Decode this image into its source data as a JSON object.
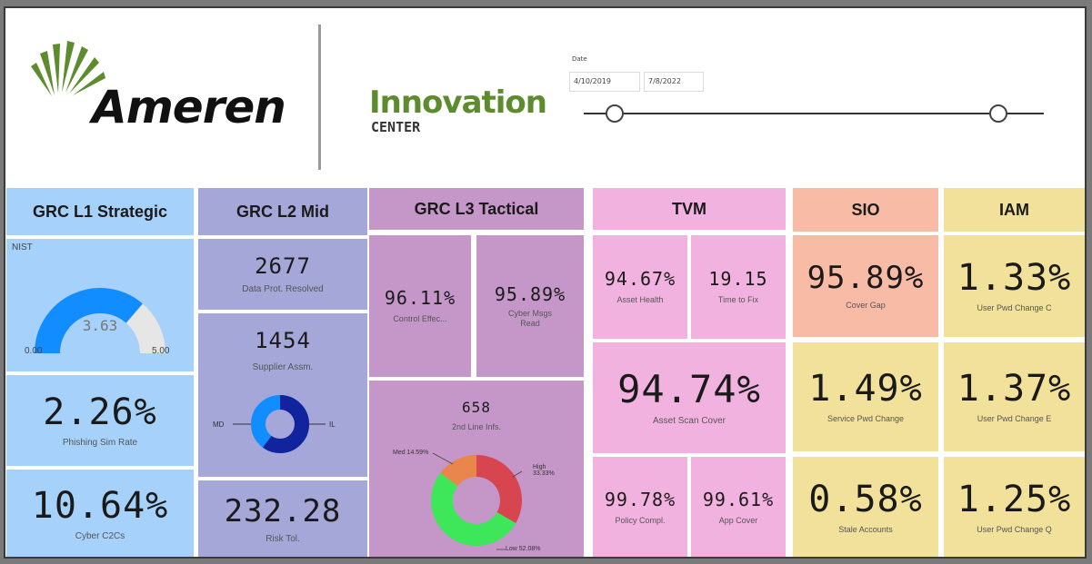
{
  "header": {
    "logo_text": "Ameren",
    "innovation": "Innovation",
    "center": "CENTER",
    "date_label": "Date",
    "date_start": "4/10/2019",
    "date_end": "7/8/2022"
  },
  "colors": {
    "l1": "#a6d1fb",
    "l2": "#a4a7d8",
    "l3": "#c597c9",
    "tvm": "#f2b2e0",
    "sio": "#f8bba6",
    "iam": "#f2e19a",
    "gauge_fill": "#118dff",
    "gauge_rest": "#e6e6e6",
    "donut_dark": "#12239e",
    "donut_light": "#118dff",
    "high": "#d64550",
    "med": "#e8864e",
    "low": "#3ee65a"
  },
  "l1": {
    "title": "GRC L1 Strategic",
    "gauge": {
      "label": "NIST",
      "value": 3.63,
      "value_text": "3.63",
      "min": 0,
      "max": 5,
      "min_text": "0.00",
      "max_text": "5.00"
    },
    "phishing": {
      "value": "2.26%",
      "label": "Phishing Sim Rate"
    },
    "c2c": {
      "value": "10.64%",
      "label": "Cyber C2Cs"
    }
  },
  "l2": {
    "title": "GRC L2 Mid",
    "data_prot": {
      "value": "2677",
      "label": "Data Prot. Resolved"
    },
    "supplier": {
      "value": "1454",
      "label": "Supplier Assm."
    },
    "donut": {
      "left_label": "MD",
      "right_label": "IL",
      "dark_share": 0.6
    },
    "risk": {
      "value": "232.28",
      "label": "Risk Tol."
    }
  },
  "l3": {
    "title": "GRC L3 Tactical",
    "control": {
      "value": "96.11%",
      "label": "Control Effec..."
    },
    "cyber_msgs": {
      "value": "95.89%",
      "label_line1": "Cyber Msgs",
      "label_line2": "Read"
    },
    "second_line": {
      "value": "658",
      "label": "2nd Line Infs."
    },
    "chart_data": {
      "type": "pie",
      "categories": [
        "High",
        "Med",
        "Low"
      ],
      "values": [
        33.33,
        14.59,
        52.08
      ],
      "labels": [
        "High 33.33%",
        "Med 14.59%",
        "Low 52.08%"
      ]
    }
  },
  "tvm": {
    "title": "TVM",
    "asset_health": {
      "value": "94.67%",
      "label": "Asset Health"
    },
    "time_fix": {
      "value": "19.15",
      "label": "Time to Fix"
    },
    "scan_cover": {
      "value": "94.74%",
      "label": "Asset Scan Cover"
    },
    "policy": {
      "value": "99.78%",
      "label": "Policy Compl."
    },
    "app_cover": {
      "value": "99.61%",
      "label": "App Cover"
    }
  },
  "sio": {
    "title": "SIO",
    "cover_gap": {
      "value": "95.89%",
      "label": "Cover Gap"
    },
    "service_pwd": {
      "value": "1.49%",
      "label": "Service Pwd Change"
    },
    "stale": {
      "value": "0.58%",
      "label": "Stale Accounts"
    }
  },
  "iam": {
    "title": "IAM",
    "pwd_c": {
      "value": "1.33%",
      "label": "User Pwd Change C"
    },
    "pwd_e": {
      "value": "1.37%",
      "label": "User Pwd Change E"
    },
    "pwd_q": {
      "value": "1.25%",
      "label": "User Pwd Change Q"
    }
  }
}
